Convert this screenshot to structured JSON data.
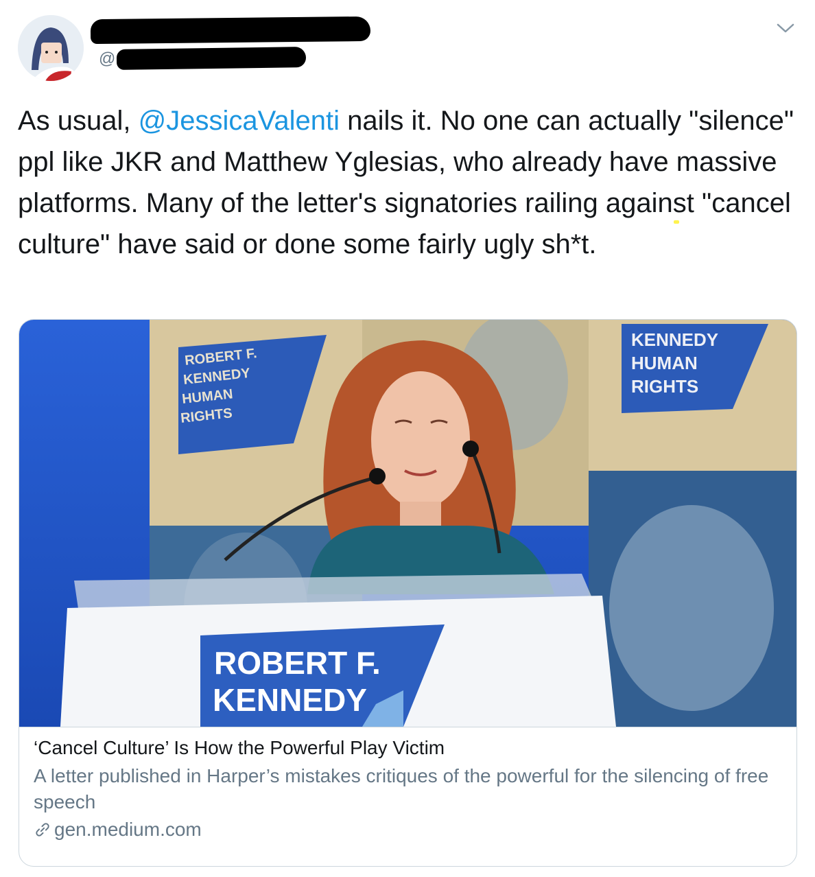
{
  "tweet": {
    "handle_prefix": "@",
    "text_before_mention": "As usual, ",
    "mention": "@JessicaValenti",
    "text_after_mention": " nails it. No one can actually \"silence\" ppl like JKR and Matthew Yglesias, who already have ",
    "highlighted": "massive platforms",
    "text_end": ". Many of the letter's signatories railing against \"cancel culture\" have said or done some fairly ugly sh*t."
  },
  "card": {
    "image_text": {
      "podium_line1": "ROBERT F.",
      "podium_line2": "KENNEDY",
      "backdrop_left": [
        "ROBERT F.",
        "KENNEDY",
        "HUMAN",
        "RIGHTS"
      ],
      "backdrop_right": [
        "KENNEDY",
        "HUMAN",
        "RIGHTS"
      ]
    },
    "title": "‘Cancel Culture’ Is How the Powerful Play Victim",
    "description": "A letter published in Harper’s mistakes critiques of the powerful for the silencing of free speech",
    "domain": "gen.medium.com"
  },
  "colors": {
    "mention": "#1b95e0",
    "highlight": "#fff34f",
    "secondary_text": "#657786",
    "border": "#ccd6dd"
  },
  "icons": [
    "avatar",
    "chevron-down-icon",
    "link-icon"
  ]
}
